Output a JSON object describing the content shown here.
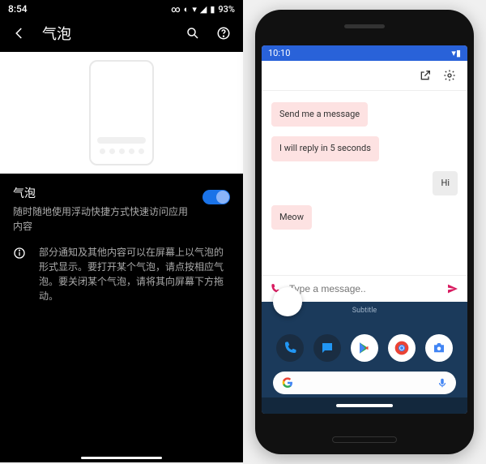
{
  "left": {
    "status": {
      "time": "8:54",
      "battery": "93%"
    },
    "title": "气泡",
    "setting": {
      "title": "气泡",
      "desc": "随时随地使用浮动快捷方式快速访问应用内容"
    },
    "info": "部分通知及其他内容可以在屏幕上以气泡的形式显示。要打开某个气泡，请点按相应气泡。要关闭某个气泡，请将其向屏幕下方拖动。"
  },
  "right": {
    "status_time": "10:10",
    "messages": [
      {
        "dir": "in",
        "text": "Send me a message"
      },
      {
        "dir": "in",
        "text": "I will reply in 5 seconds"
      },
      {
        "dir": "out",
        "text": "Hi"
      },
      {
        "dir": "in",
        "text": "Meow"
      }
    ],
    "input_placeholder": "Type a message..",
    "bubble_label": "Subtitle"
  }
}
